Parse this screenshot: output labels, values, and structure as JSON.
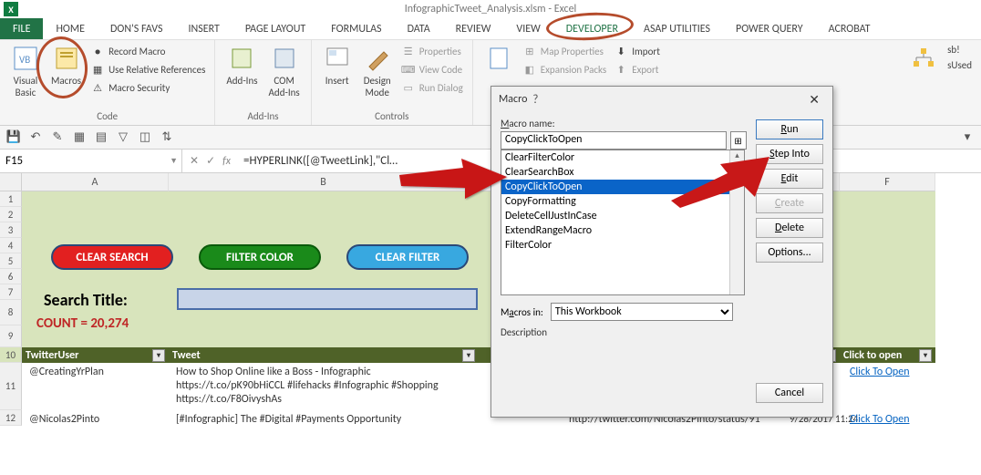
{
  "title": "InfographicTweet_Analysis.xlsm - Excel",
  "tabs": [
    "FILE",
    "HOME",
    "DON'S FAVS",
    "INSERT",
    "PAGE LAYOUT",
    "FORMULAS",
    "DATA",
    "REVIEW",
    "VIEW",
    "DEVELOPER",
    "ASAP UTILITIES",
    "POWER QUERY",
    "ACROBAT"
  ],
  "active_tab": "DEVELOPER",
  "ribbon": {
    "code": {
      "visual_basic": "Visual\nBasic",
      "macros": "Macros",
      "record_macro": "Record Macro",
      "use_rel_refs": "Use Relative References",
      "macro_security": "Macro Security",
      "label": "Code"
    },
    "addins": {
      "addins": "Add-Ins",
      "com_addins": "COM\nAdd-Ins",
      "label": "Add-Ins"
    },
    "controls": {
      "insert": "Insert",
      "design_mode": "Design\nMode",
      "properties": "Properties",
      "view_code": "View Code",
      "run_dialog": "Run Dialog",
      "label": "Controls"
    },
    "xml": {
      "map_props": "Map Properties",
      "expansion": "Expansion Packs",
      "import": "Import",
      "export": "Export"
    },
    "right": {
      "sb": "sb!",
      "used": "sUsed"
    }
  },
  "name_box": "F15",
  "formula": "=HYPERLINK([@TweetLink],\"Cl…",
  "panel": {
    "clear_search": "CLEAR SEARCH",
    "filter_color": "FILTER COLOR",
    "clear_filter": "CLEAR FILTER",
    "search_title": "Search Title:",
    "count": "COUNT = 20,274"
  },
  "columns": [
    "A",
    "B",
    "F"
  ],
  "col_widths": {
    "A": 161,
    "B": 340,
    "F": 105
  },
  "row_nums": [
    "1",
    "2",
    "3",
    "4",
    "5",
    "6",
    "7",
    "8",
    "9",
    "10",
    "11",
    "12"
  ],
  "table": {
    "headers": {
      "user": "TwitterUser",
      "tweet": "Tweet",
      "click": "Click to open"
    },
    "rows": [
      {
        "user": "@CreatingYrPlan",
        "tweet": "How to Shop Online like a Boss - Infographic https://t.co/pK90bHiCCL #lifehacks #Infographic #Shopping https://t.co/F8OivyshAs",
        "click": "Click To Open"
      },
      {
        "user": "@Nicolas2Pinto",
        "tweet": "[#Infographic] The #Digital #Payments Opportunity",
        "extra": "http://twitter.com/Nicolas2Pinto/status/91",
        "date": "9/28/2017 11:24",
        "click": "Click To Open"
      }
    ]
  },
  "dialog": {
    "title": "Macro",
    "macro_name_label": "Macro name:",
    "macro_name": "CopyClickToOpen",
    "list": [
      "ClearFilterColor",
      "ClearSearchBox",
      "CopyClickToOpen",
      "CopyFormatting",
      "DeleteCellJustInCase",
      "ExtendRangeMacro",
      "FilterColor"
    ],
    "selected": "CopyClickToOpen",
    "buttons": {
      "run": "Run",
      "step": "Step Into",
      "edit": "Edit",
      "create": "Create",
      "delete": "Delete",
      "options": "Options...",
      "cancel": "Cancel"
    },
    "macros_in_label": "Macros in:",
    "macros_in": "This Workbook",
    "description_label": "Description"
  }
}
